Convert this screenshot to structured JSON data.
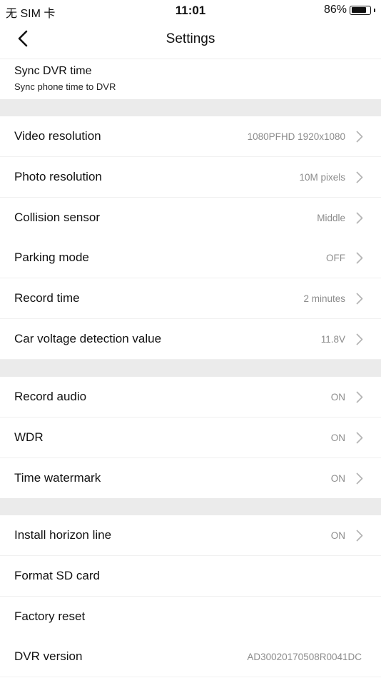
{
  "status": {
    "carrier": "无 SIM 卡",
    "time": "11:01",
    "battery": "86%",
    "battery_level": 0.86
  },
  "nav": {
    "title": "Settings"
  },
  "sync": {
    "title": "Sync DVR time",
    "subtitle": "Sync phone time to DVR"
  },
  "group1": [
    {
      "label": "Video resolution",
      "value": "1080PFHD 1920x1080"
    },
    {
      "label": "Photo resolution",
      "value": "10M pixels"
    },
    {
      "label": "Collision sensor",
      "value": "Middle"
    },
    {
      "label": "Parking mode",
      "value": "OFF"
    },
    {
      "label": "Record time",
      "value": "2 minutes"
    },
    {
      "label": "Car voltage detection value",
      "value": "11.8V"
    }
  ],
  "group2": [
    {
      "label": "Record audio",
      "value": "ON"
    },
    {
      "label": "WDR",
      "value": "ON"
    },
    {
      "label": "Time watermark",
      "value": "ON"
    }
  ],
  "group3": [
    {
      "label": "Install horizon line",
      "value": "ON"
    },
    {
      "label": "Format SD card",
      "value": ""
    },
    {
      "label": "Factory reset",
      "value": ""
    },
    {
      "label": "DVR version",
      "value": "AD30020170508R0041DC"
    }
  ]
}
